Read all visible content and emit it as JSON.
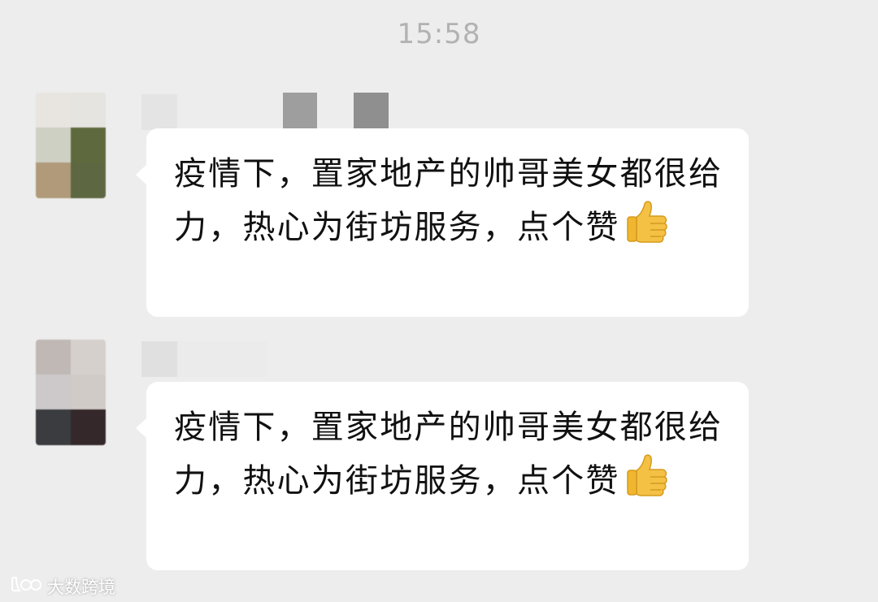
{
  "timestamp": "15:58",
  "messages": [
    {
      "text": "疫情下，置家地产的帅哥美女都很给力，热心为街坊服务，点个赞",
      "emoji": "thumbs-up",
      "avatar_colors": [
        "#e8e4df",
        "#e6e4e0",
        "#cfd0c4",
        "#5e6a3e",
        "#b19a7a",
        "#5d6842"
      ]
    },
    {
      "text": "疫情下，置家地产的帅哥美女都很给力，热心为街坊服务，点个赞",
      "emoji": "thumbs-up",
      "avatar_colors": [
        "#c0b8b5",
        "#d6d0cd",
        "#cdc9ca",
        "#d1cbc8",
        "#3a3c40",
        "#35282a"
      ]
    }
  ],
  "watermark": {
    "text": "大数跨境",
    "logo_icon": "brand-logo-icon"
  },
  "colors": {
    "background": "#ededed",
    "bubble": "#ffffff",
    "timestamp": "#b2b2b2",
    "text": "#111111"
  }
}
